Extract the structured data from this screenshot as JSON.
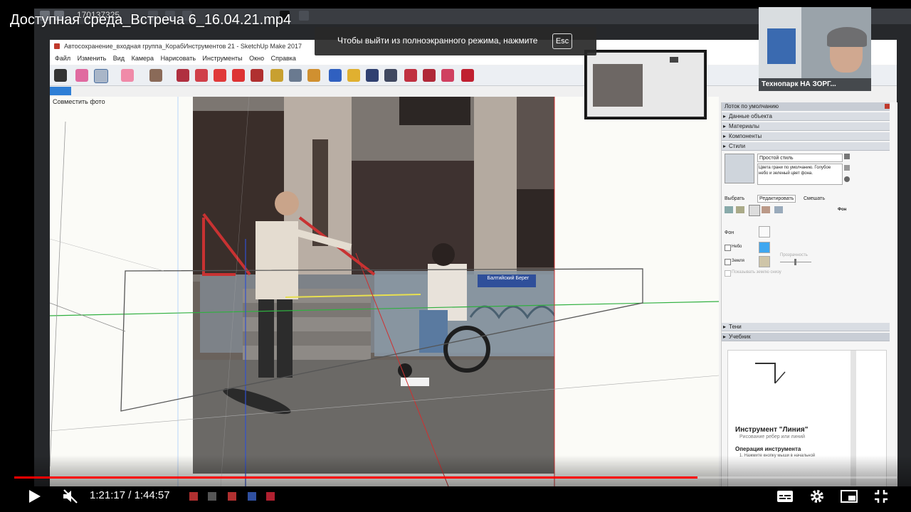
{
  "video": {
    "title": "Доступная среда_Встреча 6_16.04.21.mp4",
    "time_current": "1:21:17",
    "time_separator": " / ",
    "time_total": "1:44:57",
    "progress": 0.774,
    "volume_muted": true
  },
  "fullscreen_notice": {
    "text": "Чтобы выйти из полноэкранного режима, нажмите",
    "key": "Esc"
  },
  "remote_session": {
    "id": "170137325"
  },
  "webcam": {
    "label": "Технопарк НА ЗОРГ..."
  },
  "sketchup": {
    "title": "Автосохранение_входная группа_КорабИнструментов 21 - SketchUp Make 2017",
    "menu": [
      "Файл",
      "Изменить",
      "Вид",
      "Камера",
      "Нарисовать",
      "Инструменты",
      "Окно",
      "Справка"
    ],
    "viewport_label": "Совместить фото",
    "tray": {
      "header": "Лоток по умолчанию",
      "panels": [
        "Данные объекта",
        "Материалы",
        "Компоненты",
        "Стили"
      ],
      "style_name": "Простой стиль",
      "style_desc": "Цвета грани по умолчанию. Голубое небо и зеленый цвет фона.",
      "tabs": [
        "Выбрать",
        "Редактировать",
        "Смешать"
      ],
      "bg_label": "Фон",
      "settings": {
        "background": "Фон",
        "sky": "Небо",
        "ground": "Земля",
        "transparency": "Прозрачность",
        "show_ground_from_below": "Показывать землю снизу"
      },
      "lower_panels": [
        "Тени",
        "Учебник"
      ],
      "instructor_title": "Инструмент \"Линия\"",
      "instructor_sub": "Рисование ребер или линий",
      "instructor_op": "Операция инструмента",
      "instructor_step": "1. Нажмите кнопку мыши в начальной"
    },
    "photo_sign": "Балтийский Берег"
  },
  "colors": {
    "progress": "#ff0000",
    "sky_swatch": "#3fa7f0",
    "ground_swatch": "#cfc5a8",
    "axis_red": "#d03030",
    "axis_green": "#2fa03a",
    "axis_blue": "#3050d0"
  }
}
